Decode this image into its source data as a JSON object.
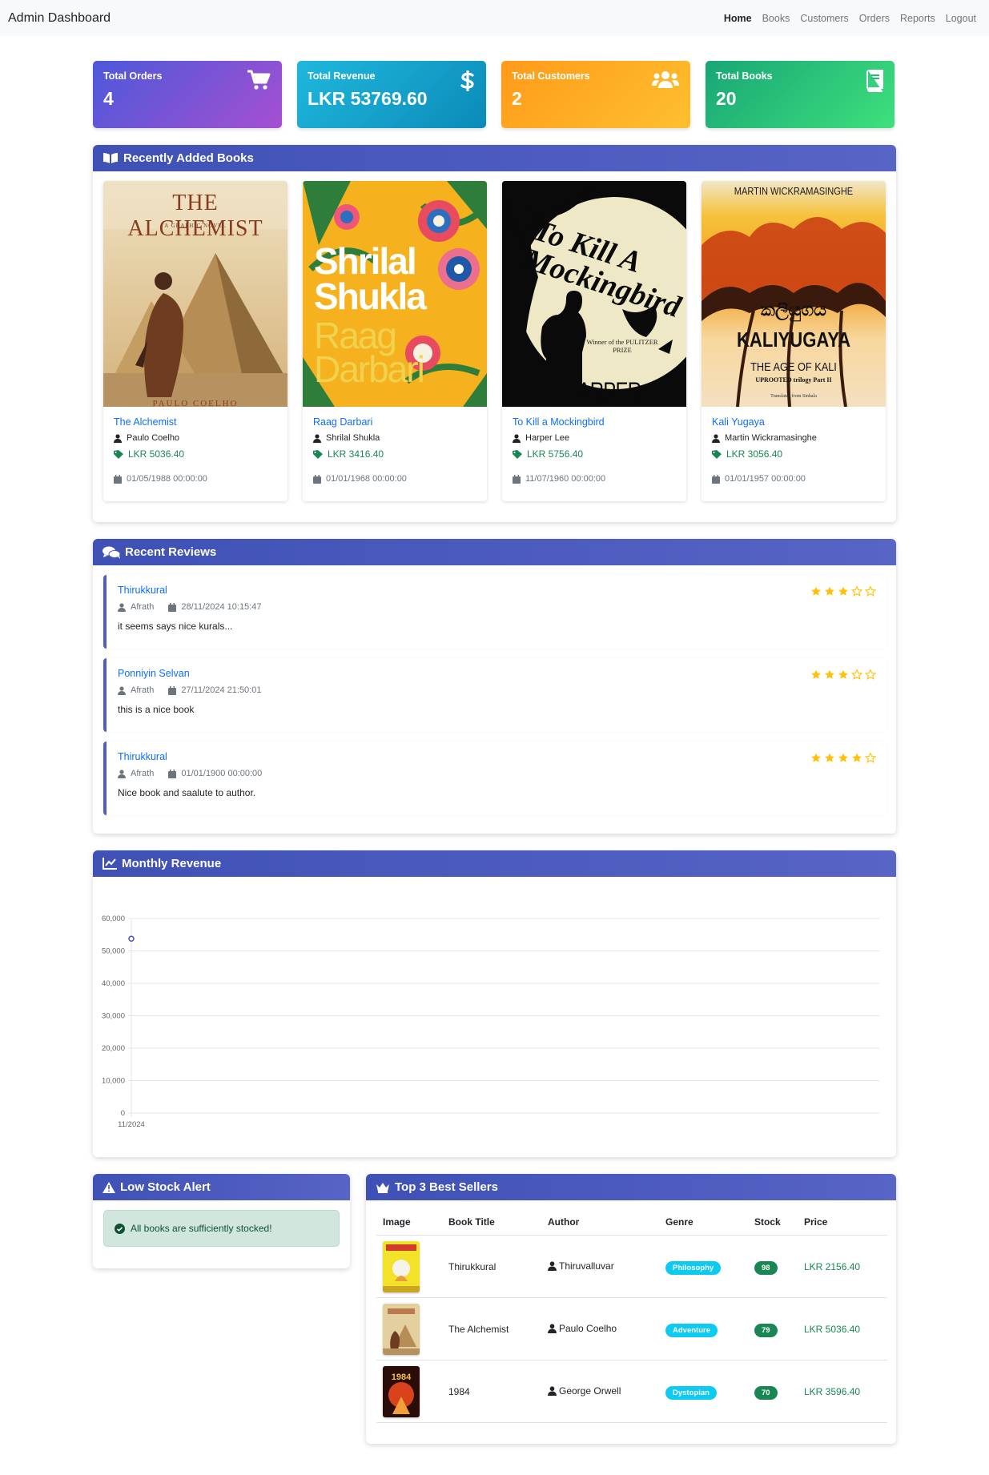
{
  "nav": {
    "brand": "Admin Dashboard",
    "items": [
      "Home",
      "Books",
      "Customers",
      "Orders",
      "Reports",
      "Logout"
    ]
  },
  "stats": [
    {
      "label": "Total Orders",
      "value": "4",
      "icon": "cart-icon"
    },
    {
      "label": "Total Revenue",
      "value": "LKR 53769.60",
      "icon": "dollar-icon"
    },
    {
      "label": "Total Customers",
      "value": "2",
      "icon": "users-icon"
    },
    {
      "label": "Total Books",
      "value": "20",
      "icon": "book-icon"
    }
  ],
  "recent_books": {
    "heading": "Recently Added Books",
    "items": [
      {
        "title": "The Alchemist",
        "author": "Paulo Coelho",
        "price": "LKR 5036.40",
        "date": "01/05/1988 00:00:00",
        "cover_title": "THE ALCHEMIST",
        "cover_sub": "A GRAPHIC NOVEL",
        "cover_author": "PAULO COELHO"
      },
      {
        "title": "Raag Darbari",
        "author": "Shrilal Shukla",
        "price": "LKR 3416.40",
        "date": "01/01/1968 00:00:00",
        "cover_author1": "Shrilal",
        "cover_author2": "Shukla",
        "cover_title1": "Raag",
        "cover_title2": "Darbari"
      },
      {
        "title": "To Kill a Mockingbird",
        "author": "Harper Lee",
        "price": "LKR 5756.40",
        "date": "11/07/1960 00:00:00",
        "cover_title": "To Kill A Mockingbird",
        "cover_award": "Winner of the PULITZER PRIZE",
        "cover_author": "HARPER LEE"
      },
      {
        "title": "Kali Yugaya",
        "author": "Martin Wickramasinghe",
        "price": "LKR 3056.40",
        "date": "01/01/1957 00:00:00",
        "cover_author": "MARTIN WICKRAMASINGHE",
        "cover_native": "කලියුගය",
        "cover_title": "KALIYUGAYA",
        "cover_sub": "THE AGE OF KALI",
        "cover_series": "UPROOTED trilogy Part II",
        "cover_trans": "Translated from Sinhala"
      }
    ]
  },
  "reviews": {
    "heading": "Recent Reviews",
    "items": [
      {
        "book": "Thirukkural",
        "user": "Afrath",
        "date": "28/11/2024 10:15:47",
        "text": "it seems says nice kurals...",
        "rating": 3
      },
      {
        "book": "Ponniyin Selvan",
        "user": "Afrath",
        "date": "27/11/2024 21:50:01",
        "text": "this is a nice book",
        "rating": 3
      },
      {
        "book": "Thirukkural",
        "user": "Afrath",
        "date": "01/01/1900 00:00:00",
        "text": "Nice book and saalute to author.",
        "rating": 4
      }
    ]
  },
  "revenue": {
    "heading": "Monthly Revenue"
  },
  "chart_data": {
    "type": "line",
    "categories": [
      "11/2024"
    ],
    "series": [
      {
        "values": [
          53769.6
        ]
      }
    ],
    "ylim": [
      0,
      60000
    ],
    "yticks": [
      "0",
      "10,000",
      "20,000",
      "30,000",
      "40,000",
      "50,000",
      "60,000"
    ],
    "grid": true,
    "color": "#4b4fc4"
  },
  "low_stock": {
    "heading": "Low Stock Alert",
    "message": "All books are sufficiently stocked!"
  },
  "best_sellers": {
    "heading": "Top 3 Best Sellers",
    "columns": [
      "Image",
      "Book Title",
      "Author",
      "Genre",
      "Stock",
      "Price"
    ],
    "rows": [
      {
        "title": "Thirukkural",
        "author": "Thiruvalluvar",
        "genre": "Philosophy",
        "stock": "98",
        "price": "LKR 2156.40"
      },
      {
        "title": "The Alchemist",
        "author": "Paulo Coelho",
        "genre": "Adventure",
        "stock": "79",
        "price": "LKR 5036.40"
      },
      {
        "title": "1984",
        "author": "George Orwell",
        "genre": "Dystopian",
        "stock": "70",
        "price": "LKR 3596.40",
        "cover_text": "1984"
      }
    ]
  }
}
